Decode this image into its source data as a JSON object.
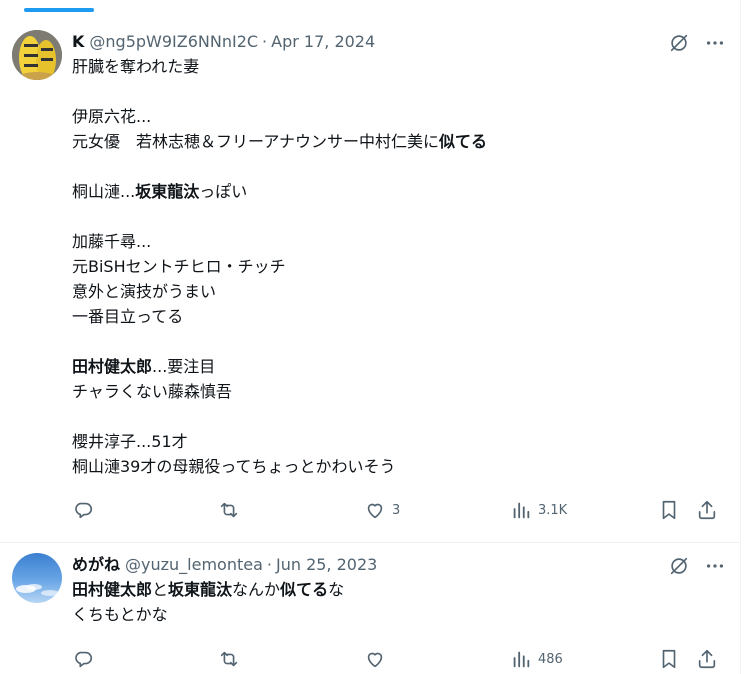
{
  "colors": {
    "accent": "#1d9bf0",
    "text": "#0f1419",
    "muted": "#536471",
    "border": "#eff3f4"
  },
  "tweets": [
    {
      "name": "K",
      "handle": "@ng5pW9IZ6NNnI2C",
      "separator": "·",
      "date": "Apr 17, 2024",
      "lines": [
        [
          {
            "t": "肝臓を奪われた妻"
          }
        ],
        [],
        [
          {
            "t": "伊原六花..."
          }
        ],
        [
          {
            "t": "元女優　若林志穂＆フリーアナウンサー中村仁美に"
          },
          {
            "t": "似てる",
            "b": true
          }
        ],
        [],
        [
          {
            "t": "桐山漣..."
          },
          {
            "t": "坂東龍汰",
            "b": true
          },
          {
            "t": "っぽい"
          }
        ],
        [],
        [
          {
            "t": "加藤千尋..."
          }
        ],
        [
          {
            "t": "元BiSHセントチヒロ・チッチ"
          }
        ],
        [
          {
            "t": "意外と演技がうまい"
          }
        ],
        [
          {
            "t": "一番目立ってる"
          }
        ],
        [],
        [
          {
            "t": "田村健太郎",
            "b": true
          },
          {
            "t": "...要注目"
          }
        ],
        [
          {
            "t": "チャラくない藤森慎吾"
          }
        ],
        [],
        [
          {
            "t": "櫻井淳子...51才"
          }
        ],
        [
          {
            "t": "桐山漣39才の母親役ってちょっとかわいそう"
          }
        ]
      ],
      "stats": {
        "replies": "",
        "reposts": "",
        "likes": "3",
        "views": "3.1K"
      }
    },
    {
      "name": "めがね",
      "handle": "@yuzu_lemontea",
      "separator": "·",
      "date": "Jun 25, 2023",
      "lines": [
        [
          {
            "t": "田村健太郎",
            "b": true
          },
          {
            "t": "と"
          },
          {
            "t": "坂東龍汰",
            "b": true
          },
          {
            "t": "なんか"
          },
          {
            "t": "似てる",
            "b": true
          },
          {
            "t": "な"
          }
        ],
        [
          {
            "t": "くちもとかな"
          }
        ]
      ],
      "stats": {
        "replies": "",
        "reposts": "",
        "likes": "",
        "views": "486"
      }
    }
  ],
  "icons": {
    "hide": "grok-slash-icon",
    "more": "more-dots-icon",
    "reply": "reply-icon",
    "repost": "repost-icon",
    "like": "like-icon",
    "views": "views-icon",
    "bookmark": "bookmark-icon",
    "share": "share-icon"
  }
}
